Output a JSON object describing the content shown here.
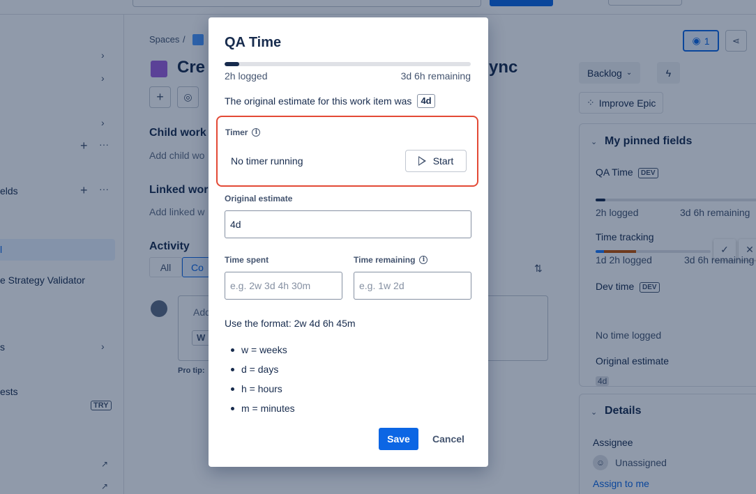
{
  "sidebar": {
    "items": [
      {
        "label": "elds"
      },
      {
        "label": "e Strategy Validator"
      },
      {
        "label": "s"
      },
      {
        "label": "ests",
        "badge": "TRY"
      }
    ],
    "selected_label": "l"
  },
  "issue": {
    "breadcrumb": "Spaces",
    "title_prefix": "Cre",
    "title_suffix": "ync",
    "child_work_heading": "Child work",
    "child_work_sub": "Add child wo",
    "linked_work_heading": "Linked wor",
    "linked_work_sub": "Add linked w",
    "activity_heading": "Activity",
    "activity_tab_all": "All",
    "activity_tab_comments": "Co",
    "comment_placeholder": "Add",
    "comment_chip": "W",
    "pro_tip": "Pro tip:"
  },
  "right_panel": {
    "watch_count": "1",
    "status_button": "Backlog",
    "improve_button": "Improve Epic",
    "pinned_title": "My pinned fields",
    "qa_time_label": "QA Time",
    "qa_logged": "2h logged",
    "qa_remaining": "3d 6h remaining",
    "time_tracking_label": "Time tracking",
    "tt_logged": "1d 2h logged",
    "tt_remaining": "3d 6h remaining",
    "dev_time_label": "Dev time",
    "dev_badge": "DEV",
    "no_time_logged": "No time logged",
    "original_estimate_label": "Original estimate",
    "original_estimate_value": "4d",
    "details_title": "Details",
    "assignee_label": "Assignee",
    "assignee_value": "Unassigned",
    "assign_to_me": "Assign to me"
  },
  "modal": {
    "title": "QA Time",
    "progress_fraction": 0.06,
    "logged": "2h logged",
    "remaining": "3d 6h remaining",
    "original_note": "The original estimate for this work item was",
    "original_value": "4d",
    "timer_label": "Timer",
    "timer_status": "No timer running",
    "start_button": "Start",
    "original_estimate_label": "Original estimate",
    "original_estimate_value": "4d",
    "time_spent_label": "Time spent",
    "time_spent_placeholder": "e.g. 2w 3d 4h 30m",
    "time_remaining_label": "Time remaining",
    "time_remaining_placeholder": "e.g. 1w 2d",
    "format_note": "Use the format: 2w 4d 6h 45m",
    "format_items": [
      "w = weeks",
      "d = days",
      "h = hours",
      "m = minutes"
    ],
    "save_button": "Save",
    "cancel_button": "Cancel"
  },
  "colors": {
    "primary": "#0c66e4",
    "highlight_border": "#e34935",
    "overlay": "rgba(9,30,66,0.45)",
    "epic_purple": "#9f5ddc"
  }
}
